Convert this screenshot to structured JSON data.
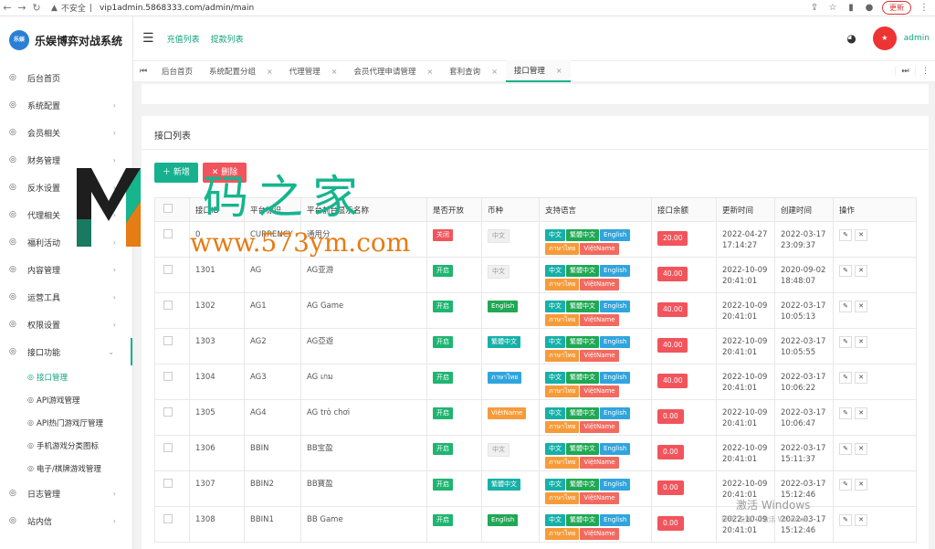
{
  "browser": {
    "insecure": "不安全",
    "url": "vip1admin.5868333.com/admin/main",
    "update": "更新"
  },
  "brand": {
    "name": "乐娱博弈对战系统",
    "logo_text": "乐娱"
  },
  "sidebar": {
    "items": [
      {
        "label": "后台首页",
        "arrow": false
      },
      {
        "label": "系统配置",
        "arrow": true
      },
      {
        "label": "会员相关",
        "arrow": true
      },
      {
        "label": "财务管理",
        "arrow": true
      },
      {
        "label": "反水设置",
        "arrow": true
      },
      {
        "label": "代理相关",
        "arrow": true
      },
      {
        "label": "福利活动",
        "arrow": true
      },
      {
        "label": "内容管理",
        "arrow": true
      },
      {
        "label": "运营工具",
        "arrow": true
      },
      {
        "label": "权限设置",
        "arrow": true
      },
      {
        "label": "接口功能",
        "arrow": true,
        "open": true
      }
    ],
    "sub_items": [
      {
        "label": "接口管理",
        "active": true
      },
      {
        "label": "API游戏管理"
      },
      {
        "label": "API热门游戏厅管理"
      },
      {
        "label": "手机游戏分类图标"
      },
      {
        "label": "电子/棋牌游戏管理"
      }
    ],
    "bottom_items": [
      {
        "label": "日志管理",
        "arrow": true
      },
      {
        "label": "站内信",
        "arrow": true
      }
    ]
  },
  "topbar": {
    "links": [
      "充值列表",
      "提款列表"
    ],
    "admin": "admin"
  },
  "tabs": [
    "后台首页",
    "系统配置分组",
    "代理管理",
    "会员代理申请管理",
    "套利查询",
    "接口管理"
  ],
  "panel": {
    "title": "接口列表",
    "add": "新增",
    "delete": "删除"
  },
  "table": {
    "headers": [
      "",
      "接口ID",
      "平台标识",
      "平台前台显示名称",
      "是否开放",
      "币种",
      "支持语言",
      "接口余额",
      "更新时间",
      "创建时间",
      "操作"
    ],
    "rows": [
      {
        "id": "0",
        "code": "CURRENCY",
        "name": "通用分",
        "open": "关闭",
        "currency": "中文",
        "langs": [
          "中文",
          "繁體中文",
          "English",
          "ภาษาไทย",
          "ViệtName"
        ],
        "balance": "20.00",
        "updated": [
          "2022-04-27",
          "17:14:27"
        ],
        "created": [
          "2022-03-17",
          "23:09:37"
        ]
      },
      {
        "id": "1301",
        "code": "AG",
        "name": "AG亚游",
        "open": "开启",
        "currency": "中文",
        "langs": [
          "中文",
          "繁體中文",
          "English",
          "ภาษาไทย",
          "ViệtName"
        ],
        "balance": "40.00",
        "updated": [
          "2022-10-09",
          "20:41:01"
        ],
        "created": [
          "2020-09-02",
          "18:48:07"
        ]
      },
      {
        "id": "1302",
        "code": "AG1",
        "name": "AG Game",
        "open": "开启",
        "currency": "English",
        "langs": [
          "中文",
          "繁體中文",
          "English",
          "ภาษาไทย",
          "ViệtName"
        ],
        "balance": "40.00",
        "updated": [
          "2022-10-09",
          "20:41:01"
        ],
        "created": [
          "2022-03-17",
          "10:05:13"
        ]
      },
      {
        "id": "1303",
        "code": "AG2",
        "name": "AG亞遊",
        "open": "开启",
        "currency": "繁體中文",
        "langs": [
          "中文",
          "繁體中文",
          "English",
          "ภาษาไทย",
          "ViệtName"
        ],
        "balance": "40.00",
        "updated": [
          "2022-10-09",
          "20:41:01"
        ],
        "created": [
          "2022-03-17",
          "10:05:55"
        ]
      },
      {
        "id": "1304",
        "code": "AG3",
        "name": "AG เกม",
        "open": "开启",
        "currency": "ภาษาไทย",
        "langs": [
          "中文",
          "繁體中文",
          "English",
          "ภาษาไทย",
          "ViệtName"
        ],
        "balance": "40.00",
        "updated": [
          "2022-10-09",
          "20:41:01"
        ],
        "created": [
          "2022-03-17",
          "10:06:22"
        ]
      },
      {
        "id": "1305",
        "code": "AG4",
        "name": "AG trò chơi",
        "open": "开启",
        "currency": "ViệtName",
        "langs": [
          "中文",
          "繁體中文",
          "English",
          "ภาษาไทย",
          "ViệtName"
        ],
        "balance": "0.00",
        "updated": [
          "2022-10-09",
          "20:41:01"
        ],
        "created": [
          "2022-03-17",
          "10:06:47"
        ]
      },
      {
        "id": "1306",
        "code": "BBIN",
        "name": "BB宝盈",
        "open": "开启",
        "currency": "中文",
        "langs": [
          "中文",
          "繁體中文",
          "English",
          "ภาษาไทย",
          "ViệtName"
        ],
        "balance": "0.00",
        "updated": [
          "2022-10-09",
          "20:41:01"
        ],
        "created": [
          "2022-03-17",
          "15:11:37"
        ]
      },
      {
        "id": "1307",
        "code": "BBIN2",
        "name": "BB寶盈",
        "open": "开启",
        "currency": "繁體中文",
        "langs": [
          "中文",
          "繁體中文",
          "English",
          "ภาษาไทย",
          "ViệtName"
        ],
        "balance": "0.00",
        "updated": [
          "2022-10-09",
          "20:41:01"
        ],
        "created": [
          "2022-03-17",
          "15:12:46"
        ]
      },
      {
        "id": "1308",
        "code": "BBIN1",
        "name": "BB Game",
        "open": "开启",
        "currency": "English",
        "langs": [
          "中文",
          "繁體中文",
          "English",
          "ภาษาไทย",
          "ViệtName"
        ],
        "balance": "0.00",
        "updated": [
          "2022-10-09",
          "20:41:01"
        ],
        "created": [
          "2022-03-17",
          "15:12:46"
        ]
      }
    ]
  },
  "watermark": {
    "text": "码之家",
    "url": "www.573ym.com",
    "windows": "激活 Windows",
    "windows_sub": "转到\"设置\"以激活 Windows。"
  },
  "colors": {
    "accent": "#18b18f",
    "danger": "#f1545c"
  }
}
